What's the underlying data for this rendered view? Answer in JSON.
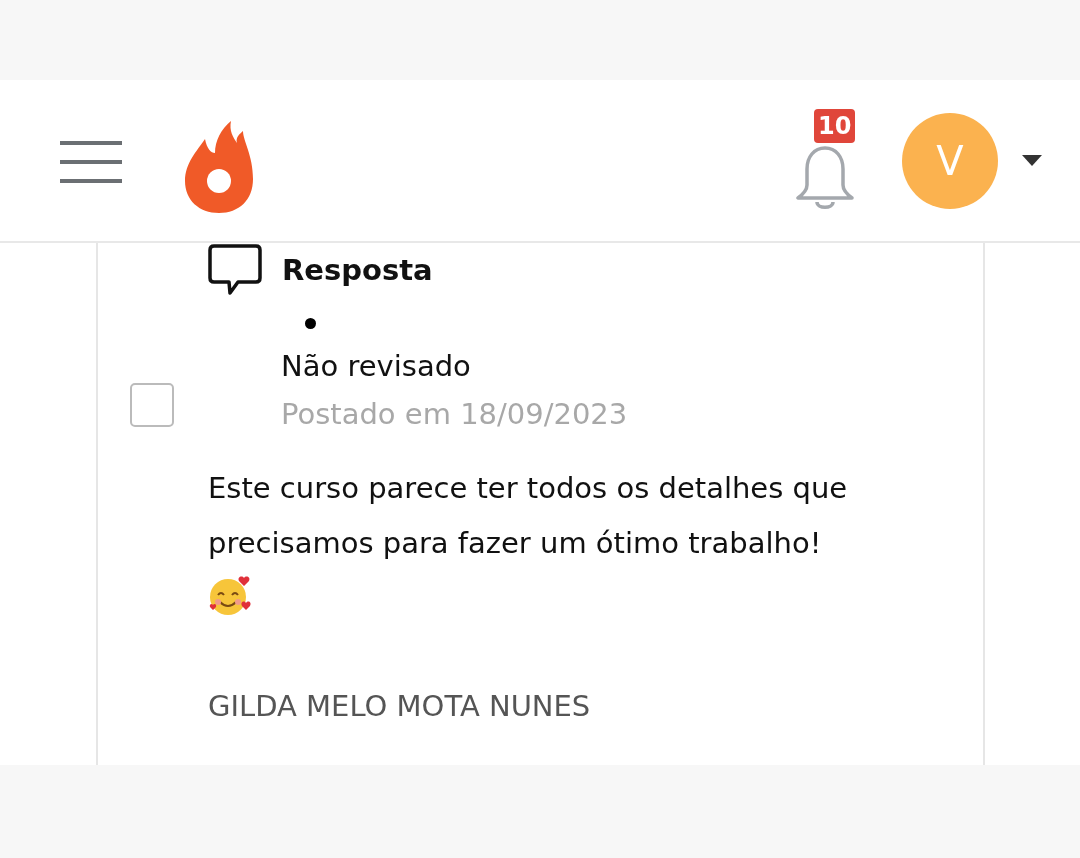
{
  "header": {
    "notifications": {
      "count": "10"
    },
    "avatar": {
      "initial": "V",
      "color": "#fbb24f"
    }
  },
  "comment": {
    "title": "Resposta",
    "status": "Não revisado",
    "posted": "Postado em 18/09/2023",
    "checked": false,
    "body": "Este curso parece ter todos os detalhes que precisamos para fazer um ótimo trabalho!",
    "author": "GILDA MELO MOTA NUNES"
  }
}
